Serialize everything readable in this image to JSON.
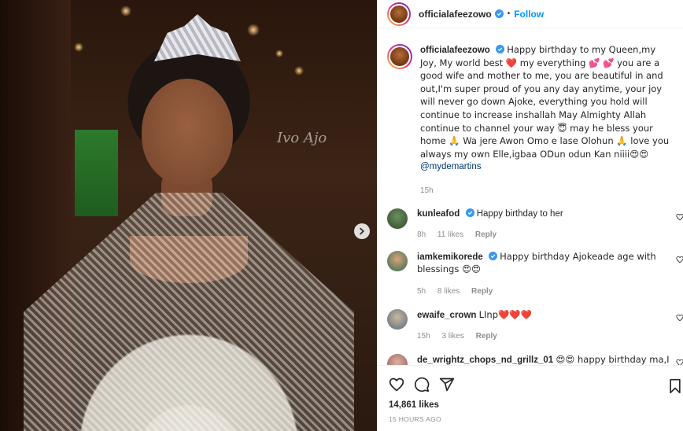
{
  "post": {
    "username": "officialafeezowo",
    "follow_label": "Follow",
    "separator": "•",
    "watermark": "Ivo Ajo",
    "caption": {
      "username": "officialafeezowo",
      "text": "Happy birthday to my Queen,my Joy, My world best ❤️ my everything 💕 💕 you are a good wife and mother to me, you are beautiful in and out,I'm super proud of you any day anytime, your joy will never go down Ajoke, everything you hold will continue to increase inshallah May Almighty Allah continue to channel your way 😇 may he bless your home 🙏 Wa jere Awon Omo e lase Olohun 🙏 love you always my own Elle,igbaa ODun odun Kan niiii😍😍",
      "mention": "@mydemartins",
      "time": "15h"
    },
    "comments": [
      {
        "username": "kunleafod",
        "verified": true,
        "text": "Happy birthday to her",
        "time": "8h",
        "likes": "11 likes",
        "reply": "Reply",
        "avatar_color": "#3a5a3a"
      },
      {
        "username": "iamkemikorede",
        "verified": true,
        "text": "Happy birthday Ajokeade age with blessings 😍😍",
        "time": "5h",
        "likes": "8 likes",
        "reply": "Reply",
        "avatar_color": "#2f6b4a"
      },
      {
        "username": "ewaife_crown",
        "verified": false,
        "text": "LInp❤️❤️❤️",
        "time": "15h",
        "likes": "3 likes",
        "reply": "Reply",
        "avatar_color": "#7a8a9a"
      },
      {
        "username": "de_wrightz_chops_nd_grillz_01",
        "verified": false,
        "text": "😍😍 happy birthday ma,I am happy for u 💐 continue to prosper in wealth and health ma..u re not just a mother..a leader role 💐 many re gone",
        "time": "",
        "likes": "",
        "reply": "",
        "avatar_color": "#b07a7a"
      }
    ],
    "likes": "14,861 likes",
    "timestamp": "15 HOURS AGO"
  },
  "colors": {
    "accent": "#0095f6",
    "verified": "#3897f0",
    "heart": "#ed4956"
  },
  "icons": [
    "verified-badge-icon",
    "like-icon",
    "comment-icon",
    "share-icon",
    "save-icon",
    "next-arrow-icon",
    "heart-small-icon"
  ]
}
